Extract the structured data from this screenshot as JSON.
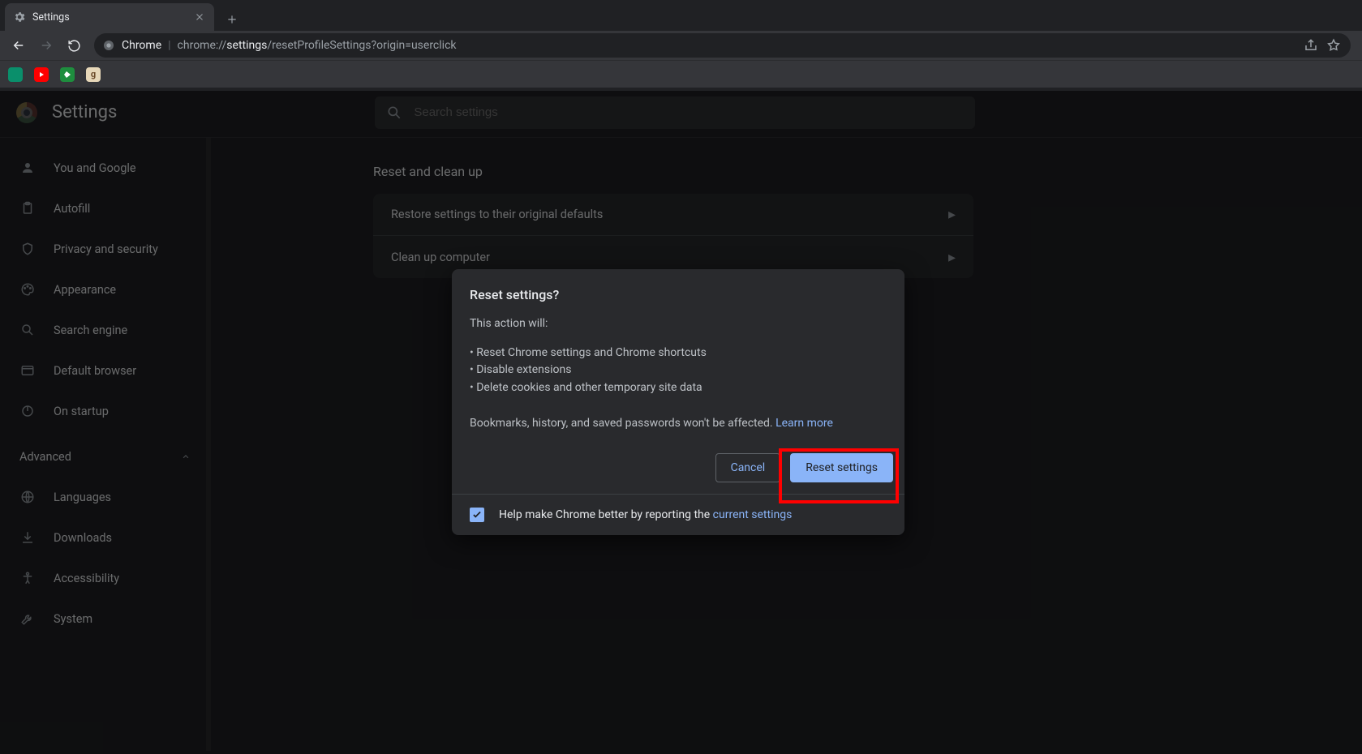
{
  "browser": {
    "tab_title": "Settings",
    "url_chip": "Chrome",
    "url_dim1": "chrome://",
    "url_hl": "settings",
    "url_dim2": "/resetProfileSettings?origin=userclick"
  },
  "header": {
    "title": "Settings",
    "search_placeholder": "Search settings"
  },
  "sidebar": {
    "items": [
      {
        "icon": "person-icon",
        "label": "You and Google"
      },
      {
        "icon": "clipboard-icon",
        "label": "Autofill"
      },
      {
        "icon": "shield-icon",
        "label": "Privacy and security"
      },
      {
        "icon": "palette-icon",
        "label": "Appearance"
      },
      {
        "icon": "search-icon",
        "label": "Search engine"
      },
      {
        "icon": "browser-icon",
        "label": "Default browser"
      },
      {
        "icon": "power-icon",
        "label": "On startup"
      }
    ],
    "advanced_label": "Advanced",
    "adv_items": [
      {
        "icon": "globe-icon",
        "label": "Languages"
      },
      {
        "icon": "download-icon",
        "label": "Downloads"
      },
      {
        "icon": "accessibility-icon",
        "label": "Accessibility"
      },
      {
        "icon": "wrench-icon",
        "label": "System"
      }
    ]
  },
  "main": {
    "section_title": "Reset and clean up",
    "rows": [
      "Restore settings to their original defaults",
      "Clean up computer"
    ]
  },
  "modal": {
    "title": "Reset settings?",
    "intro": "This action will:",
    "bullets": [
      "Reset Chrome settings and Chrome shortcuts",
      "Disable extensions",
      "Delete cookies and other temporary site data"
    ],
    "outro_a": "Bookmarks, history, and saved passwords won't be affected. ",
    "learn_more": "Learn more",
    "cancel": "Cancel",
    "confirm": "Reset settings",
    "footer_a": "Help make Chrome better by reporting the ",
    "footer_link": "current settings",
    "checkbox_checked": true
  }
}
